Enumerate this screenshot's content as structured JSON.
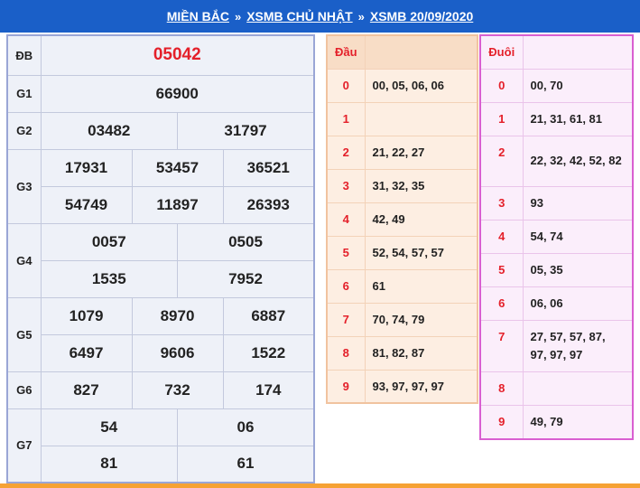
{
  "breadcrumb": {
    "items": [
      "MIỀN BẮC",
      "XSMB CHỦ NHẬT",
      "XSMB 20/09/2020"
    ],
    "separator": "»"
  },
  "results": {
    "db": {
      "label": "ĐB",
      "values": [
        "05042"
      ]
    },
    "g1": {
      "label": "G1",
      "values": [
        "66900"
      ]
    },
    "g2": {
      "label": "G2",
      "values": [
        "03482",
        "31797"
      ]
    },
    "g3": {
      "label": "G3",
      "values": [
        "17931",
        "53457",
        "36521",
        "54749",
        "11897",
        "26393"
      ]
    },
    "g4": {
      "label": "G4",
      "values": [
        "0057",
        "0505",
        "1535",
        "7952"
      ]
    },
    "g5": {
      "label": "G5",
      "values": [
        "1079",
        "8970",
        "6887",
        "6497",
        "9606",
        "1522"
      ]
    },
    "g6": {
      "label": "G6",
      "values": [
        "827",
        "732",
        "174"
      ]
    },
    "g7": {
      "label": "G7",
      "values": [
        "54",
        "06",
        "81",
        "61"
      ]
    }
  },
  "dau": {
    "header": "Đầu",
    "rows": [
      {
        "key": "0",
        "value": "00, 05, 06, 06"
      },
      {
        "key": "1",
        "value": ""
      },
      {
        "key": "2",
        "value": "21, 22, 27"
      },
      {
        "key": "3",
        "value": "31, 32, 35"
      },
      {
        "key": "4",
        "value": "42, 49"
      },
      {
        "key": "5",
        "value": "52, 54, 57, 57"
      },
      {
        "key": "6",
        "value": "61"
      },
      {
        "key": "7",
        "value": "70, 74, 79"
      },
      {
        "key": "8",
        "value": "81, 82, 87"
      },
      {
        "key": "9",
        "value": "93, 97, 97, 97"
      }
    ]
  },
  "duoi": {
    "header": "Đuôi",
    "rows": [
      {
        "key": "0",
        "value": "00, 70"
      },
      {
        "key": "1",
        "value": "21, 31, 61, 81"
      },
      {
        "key": "2",
        "value": "22, 32, 42, 52, 82"
      },
      {
        "key": "3",
        "value": "93"
      },
      {
        "key": "4",
        "value": "54, 74"
      },
      {
        "key": "5",
        "value": "05, 35"
      },
      {
        "key": "6",
        "value": "06, 06"
      },
      {
        "key": "7",
        "value": "27, 57, 57, 87, 97, 97, 97"
      },
      {
        "key": "8",
        "value": ""
      },
      {
        "key": "9",
        "value": "49, 79"
      }
    ]
  },
  "colors": {
    "header_blue": "#1a5fc8",
    "special_red": "#e4202a",
    "dau_bg": "#fdeee2",
    "duoi_border": "#d95fd1",
    "bottom_orange": "#f6a234"
  }
}
